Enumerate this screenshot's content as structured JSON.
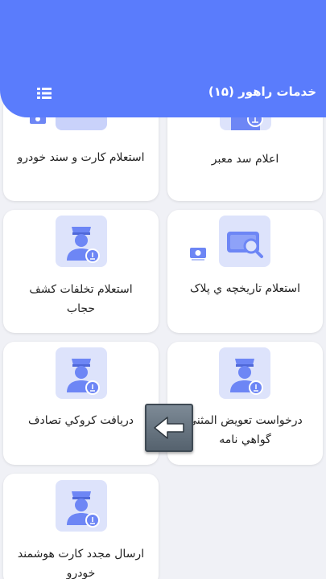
{
  "header": {
    "title": "خدمات راهور (۱۵)",
    "menu_icon": "list-icon",
    "color": "#5a7cfc"
  },
  "services": [
    {
      "label": "اعلام سد معبر",
      "icon": "police-officer-icon"
    },
    {
      "label": "استعلام کارت و سند خودرو",
      "icon": "car-card-icon"
    },
    {
      "label": "استعلام تاريخچه ي پلاک",
      "icon": "plate-search-icon"
    },
    {
      "label": "استعلام تخلفات کشف حجاب",
      "icon": "police-officer-icon"
    },
    {
      "label": "درخواست تعويض المثني گواهي نامه",
      "icon": "police-officer-icon"
    },
    {
      "label": "دريافت کروکي تصادف",
      "icon": "police-officer-icon"
    },
    {
      "label": "ارسال مجدد کارت هوشمند خودرو",
      "icon": "police-officer-icon"
    }
  ],
  "overlay": {
    "icon": "left-arrow-icon"
  },
  "colors": {
    "tile_bg": "#dde3fb",
    "icon_blue": "#6d86f5",
    "card_bg": "#ffffff",
    "page_bg": "#f0f1f6"
  }
}
